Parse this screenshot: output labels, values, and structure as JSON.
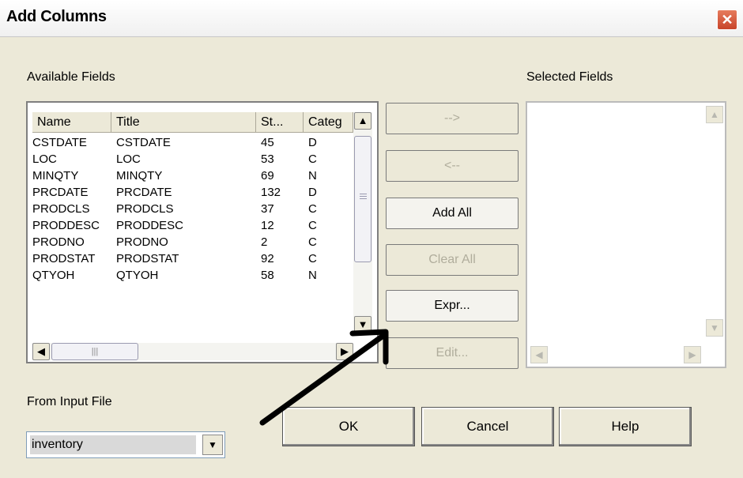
{
  "window": {
    "title": "Add Columns"
  },
  "close_icon": "close-icon",
  "available": {
    "label": "Available Fields",
    "columns": [
      "Name",
      "Title",
      "St...",
      "Categ"
    ],
    "rows": [
      [
        "CSTDATE",
        "CSTDATE",
        "45",
        "D"
      ],
      [
        "LOC",
        "LOC",
        "53",
        "C"
      ],
      [
        "MINQTY",
        "MINQTY",
        "69",
        "N"
      ],
      [
        "PRCDATE",
        "PRCDATE",
        "132",
        "D"
      ],
      [
        "PRODCLS",
        "PRODCLS",
        "37",
        "C"
      ],
      [
        "PRODDESC",
        "PRODDESC",
        "12",
        "C"
      ],
      [
        "PRODNO",
        "PRODNO",
        "2",
        "C"
      ],
      [
        "PRODSTAT",
        "PRODSTAT",
        "92",
        "C"
      ],
      [
        "QTYOH",
        "QTYOH",
        "58",
        "N"
      ]
    ]
  },
  "selected": {
    "label": "Selected Fields"
  },
  "buttons": {
    "add": "-->",
    "remove": "<--",
    "add_all": "Add All",
    "clear_all": "Clear All",
    "expr": "Expr...",
    "edit": "Edit..."
  },
  "input_file": {
    "label": "From Input File",
    "value": "inventory"
  },
  "footer": {
    "ok": "OK",
    "cancel": "Cancel",
    "help": "Help"
  }
}
